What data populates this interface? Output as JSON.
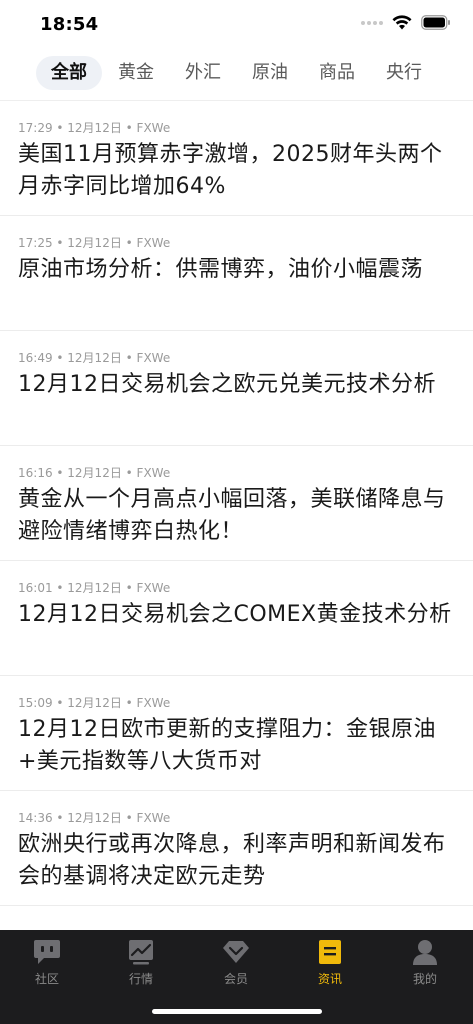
{
  "status_bar": {
    "time": "18:54",
    "icons": [
      "cellular-signal-icon",
      "wifi-icon",
      "battery-icon"
    ]
  },
  "tabs": [
    {
      "label": "全部",
      "active": true
    },
    {
      "label": "黄金",
      "active": false
    },
    {
      "label": "外汇",
      "active": false
    },
    {
      "label": "原油",
      "active": false
    },
    {
      "label": "商品",
      "active": false
    },
    {
      "label": "央行",
      "active": false
    }
  ],
  "news": [
    {
      "meta": "17:29 • 12月12日 • FXWe",
      "title": "美国11月预算赤字激增，2025财年头两个月赤字同比增加64%"
    },
    {
      "meta": "17:25 • 12月12日 • FXWe",
      "title": "原油市场分析：供需博弈，油价小幅震荡"
    },
    {
      "meta": "16:49 • 12月12日 • FXWe",
      "title": "12月12日交易机会之欧元兑美元技术分析"
    },
    {
      "meta": "16:16 • 12月12日 • FXWe",
      "title": "黄金从一个月高点小幅回落，美联储降息与避险情绪博弈白热化！"
    },
    {
      "meta": "16:01 • 12月12日 • FXWe",
      "title": "12月12日交易机会之COMEX黄金技术分析"
    },
    {
      "meta": "15:09 • 12月12日 • FXWe",
      "title": "12月12日欧市更新的支撑阻力：金银原油+美元指数等八大货币对"
    },
    {
      "meta": "14:36 • 12月12日 • FXWe",
      "title": "欧洲央行或再次降息，利率声明和新闻发布会的基调将决定欧元走势"
    }
  ],
  "bottom_nav": [
    {
      "label": "社区",
      "icon": "community-chat-icon",
      "active": false
    },
    {
      "label": "行情",
      "icon": "market-chart-icon",
      "active": false
    },
    {
      "label": "会员",
      "icon": "member-diamond-icon",
      "active": false
    },
    {
      "label": "资讯",
      "icon": "news-icon",
      "active": true
    },
    {
      "label": "我的",
      "icon": "profile-icon",
      "active": false
    }
  ],
  "colors": {
    "accent": "#f0b90b",
    "bottom_bar_bg": "#1c1c1e",
    "active_tab_bg": "#eef1f6",
    "meta_text": "#9a9a9a"
  }
}
